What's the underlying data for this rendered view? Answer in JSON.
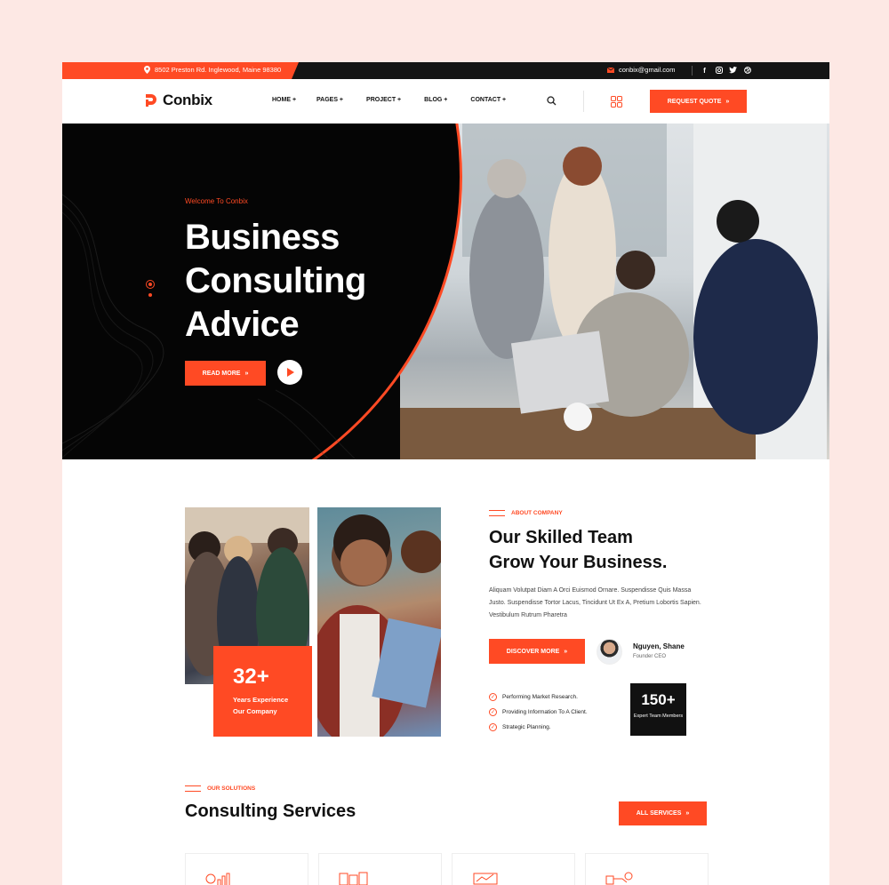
{
  "topbar": {
    "address": "8502 Preston Rd. Inglewood, Maine 98380",
    "email": "conbix@gmail.com",
    "socials": [
      "facebook-icon",
      "instagram-icon",
      "twitter-icon",
      "dribbble-icon"
    ]
  },
  "header": {
    "logo": "Conbix",
    "nav": [
      "HOME +",
      "PAGES +",
      "PROJECT +",
      "BLOG +",
      "CONTACT +"
    ],
    "quote_button": "REQUEST QUOTE"
  },
  "hero": {
    "welcome": "Welcome To Conbix",
    "title_lines": [
      "Business",
      "Consulting",
      "Advice"
    ],
    "read_more": "READ MORE"
  },
  "about": {
    "experience_number": "32+",
    "experience_label": "Years Experience Our Company",
    "tag": "ABOUT COMPANY",
    "title_lines": [
      "Our Skilled Team",
      "Grow Your Business."
    ],
    "text": "Aliquam Volutpat Diam A Orci Euismod Ornare. Suspendisse Quis Massa Justo. Suspendisse Tortor Lacus, Tincidunt Ut Ex A, Pretium Lobortis Sapien. Vestibulum Rutrum Pharetra",
    "discover_button": "DISCOVER MORE",
    "founder_name": "Nguyen, Shane",
    "founder_role": "Founder CEO",
    "checklist": [
      "Performing Market Research.",
      "Providing Information To A Client.",
      "Strategic Planning."
    ],
    "team_number": "150+",
    "team_label": "Expert Team Members"
  },
  "services": {
    "tag": "OUR SOLUTIONS",
    "title": "Consulting Services",
    "all_button": "ALL SERVICES"
  },
  "colors": {
    "accent": "#ff4a24",
    "dark": "#060606",
    "page_bg": "#fde8e4"
  }
}
